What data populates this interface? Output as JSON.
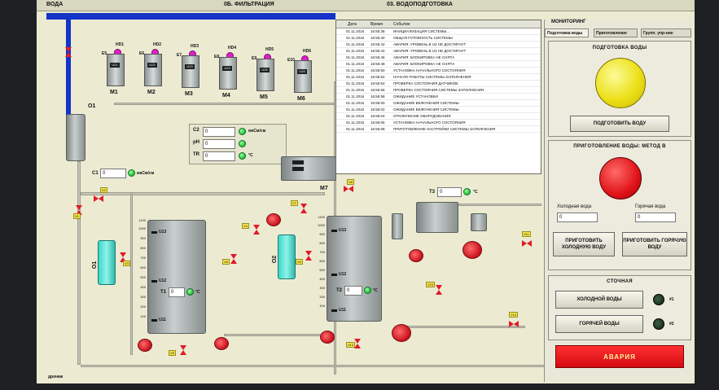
{
  "tabs_top": {
    "left": "ВОДА",
    "middle": "0Б. ФИЛЬТРАЦИЯ",
    "right": "03. ВОДОПОДГОТОВКА"
  },
  "panel_tabs": {
    "header": "МОНИТОРИНГ",
    "tab1": "Подготовка воды",
    "tab2": "Приготовление",
    "tab3": "Групп. упр-ние"
  },
  "modules": [
    {
      "hd": "HD1",
      "e": "E5",
      "u": "U21",
      "m": "M1"
    },
    {
      "hd": "HD2",
      "e": "E6",
      "u": "U22",
      "m": "M2"
    },
    {
      "hd": "HD3",
      "e": "E7",
      "u": "U23",
      "m": "M3"
    },
    {
      "hd": "HD4",
      "e": "E8",
      "u": "U24",
      "m": "M4"
    },
    {
      "hd": "HD5",
      "e": "E9",
      "u": "U25",
      "m": "M5"
    },
    {
      "hd": "HD6",
      "e": "E10",
      "u": "U26",
      "m": "M6"
    }
  ],
  "labels": {
    "o1": "O1",
    "c1": "C1",
    "c1_unit": "мкСм/см",
    "c1_value": "0",
    "m7": "M7",
    "c2": "C2",
    "c2_value": "0",
    "c2_unit": "мкСм/см",
    "ph": "pH",
    "ph_value": "0",
    "tr": "TR",
    "tr_value": "0",
    "tr_unit": "°С",
    "t1": "T1",
    "t1_value": "0",
    "t1_unit": "°С",
    "t2": "T2",
    "t2_value": "0",
    "t2_unit": "°С",
    "t3": "T3",
    "t3_value": "0",
    "t3_unit": "°С",
    "drain": "дренаж",
    "cooler1": "O1",
    "cooler2": "O2"
  },
  "tank1": {
    "top": "1100",
    "label_u13": "U13",
    "label_u12": "U12",
    "label_u11": "U11",
    "scale": [
      "1000",
      "900",
      "800",
      "700",
      "600",
      "500",
      "400",
      "300",
      "200",
      "100"
    ]
  },
  "tank2": {
    "top": "1100",
    "label_u13": "U13",
    "label_u12": "U12",
    "label_u11": "U11",
    "scale": [
      "1000",
      "900",
      "800",
      "700",
      "600",
      "500",
      "400",
      "300",
      "200",
      "100"
    ]
  },
  "valve_tags": [
    "V2",
    "V1",
    "V3",
    "V5",
    "V4",
    "V6",
    "V7",
    "V8",
    "V9",
    "V10",
    "V11",
    "V12",
    "V13"
  ],
  "log": {
    "headers": [
      "Дата",
      "Время",
      "Событие"
    ],
    "rows": [
      [
        "01.11.2016",
        "16:55:38",
        "ИНИЦИАЛИЗАЦИЯ СИСТЕМЫ..."
      ],
      [
        "01.11.2016",
        "16:55:40",
        "ОБЩАЯ ГОТОВНОСТЬ СИСТЕМЫ"
      ],
      [
        "01.11.2016",
        "16:55:42",
        "АВАРИЯ: УРОВЕНЬ В U2 НЕ ДОСТИГНУТ"
      ],
      [
        "01.11.2016",
        "16:55:44",
        "АВАРИЯ: УРОВЕНЬ В U3 НЕ ДОСТИГНУТ"
      ],
      [
        "01.11.2016",
        "16:55:46",
        "АВАРИЯ: БЛОКИРОВКА НЕ СНЯТА"
      ],
      [
        "01.11.2016",
        "16:55:48",
        "АВАРИЯ: БЛОКИРОВКА НЕ СНЯТА"
      ],
      [
        "01.11.2016",
        "16:55:50",
        "УСТАНОВКА НАЧАЛЬНОГО СОСТОЯНИЯ"
      ],
      [
        "01.11.2016",
        "16:55:52",
        "НАЧАЛО РАБОТЫ СИСТЕМЫ ЗАПОЛНЕНИЯ"
      ],
      [
        "01.11.2016",
        "16:55:54",
        "ПРОВЕРКА СОСТОЯНИЯ ДАТЧИКОВ"
      ],
      [
        "01.11.2016",
        "16:55:56",
        "ПРОВЕРКА СОСТОЯНИЯ СИСТЕМЫ ЗАПОЛНЕНИЯ"
      ],
      [
        "01.11.2016",
        "16:55:58",
        "ОЖИДАНИЕ УСТАНОВКИ"
      ],
      [
        "01.11.2016",
        "16:56:00",
        "ОЖИДАНИЕ ВКЛЮЧЕНИЯ СИСТЕМЫ"
      ],
      [
        "01.11.2016",
        "16:56:02",
        "ОЖИДАНИЕ ВКЛЮЧЕНИЯ СИСТЕМЫ"
      ],
      [
        "01.11.2016",
        "16:56:04",
        "ОТКЛЮЧЕНИЕ ОБОРУДОВАНИЯ"
      ],
      [
        "01.11.2016",
        "16:56:06",
        "УСТАНОВКА НАЧАЛЬНОГО СОСТОЯНИЯ"
      ],
      [
        "01.11.2016",
        "16:56:08",
        "ПРИГОТОВЛЕНИЕ НАСТРОЙКИ СИСТЕМЫ ЗАПОЛНЕНИЯ"
      ]
    ]
  },
  "panel": {
    "prep_title": "ПОДГОТОВКА ВОДЫ",
    "prep_button": "ПОДГОТОВИТЬ ВОДУ",
    "mix_title": "ПРИГОТОВЛЕНИЕ ВОДЫ: МЕТОД В",
    "cold_label": "Холодная вода",
    "hot_label": "Горячая вода",
    "cold_value": "0",
    "hot_value": "0",
    "cold_button": "ПРИГОТОВИТЬ ХОЛОДНУЮ ВОДУ",
    "hot_button": "ПРИГОТОВИТЬ ГОРЯЧУЮ ВОДУ",
    "drain_title": "СТОЧНАЯ",
    "drain_cold": "ХОЛОДНОЙ ВОДЫ",
    "drain_hot": "ГОРЯЧЕЙ ВОДЫ",
    "ind1": "#1",
    "ind2": "#2",
    "alarm": "АВАРИЯ"
  },
  "colors": {
    "accent": "#1433c8",
    "alarm": "#e01318",
    "lamp": "#ece018",
    "ok": "#1ec03b",
    "valve": "#e01b2a"
  }
}
